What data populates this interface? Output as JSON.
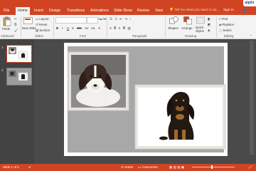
{
  "brand": {
    "logo_text": "alphr"
  },
  "title_bar": {
    "signin_label": "Sign in",
    "share_label": "Share"
  },
  "tabs": [
    {
      "label": "File"
    },
    {
      "label": "Home",
      "active": true
    },
    {
      "label": "Insert"
    },
    {
      "label": "Design"
    },
    {
      "label": "Transitions"
    },
    {
      "label": "Animations"
    },
    {
      "label": "Slide Show"
    },
    {
      "label": "Review"
    },
    {
      "label": "View"
    }
  ],
  "search": {
    "placeholder": "Tell me what you want to do..."
  },
  "ribbon": {
    "clipboard": {
      "paste_label": "Paste",
      "group_label": "Clipboard"
    },
    "slides": {
      "new_slide_label": "New Slide",
      "layout_label": "Layout",
      "reset_label": "Reset",
      "section_label": "Section",
      "group_label": "Slides"
    },
    "font": {
      "group_label": "Font",
      "buttons": [
        "B",
        "I",
        "U",
        "S",
        "abc",
        "AV",
        "Aa",
        "A"
      ]
    },
    "paragraph": {
      "group_label": "Paragraph"
    },
    "drawing": {
      "shapes_label": "Shapes",
      "arrange_label": "Arrange",
      "quick_styles_label": "Quick Styles",
      "group_label": "Drawing"
    },
    "editing": {
      "find_label": "Find",
      "replace_label": "Replace",
      "select_label": "Select",
      "group_label": "Editing"
    }
  },
  "slide_panel": {
    "slides": [
      {
        "number": "1"
      },
      {
        "number": "2"
      }
    ]
  },
  "status_bar": {
    "slide_counter": "Slide 1 of 2",
    "notes_label": "Notes",
    "comments_label": "Comments"
  },
  "colors": {
    "accent": "#d04423",
    "ribbon_bg": "#f3f3f3",
    "editor_bg": "#4a4a4a"
  },
  "icons": [
    "paste-icon",
    "new-slide-icon",
    "shapes-icon",
    "arrange-icon",
    "find-icon",
    "notes-icon",
    "comments-icon"
  ]
}
